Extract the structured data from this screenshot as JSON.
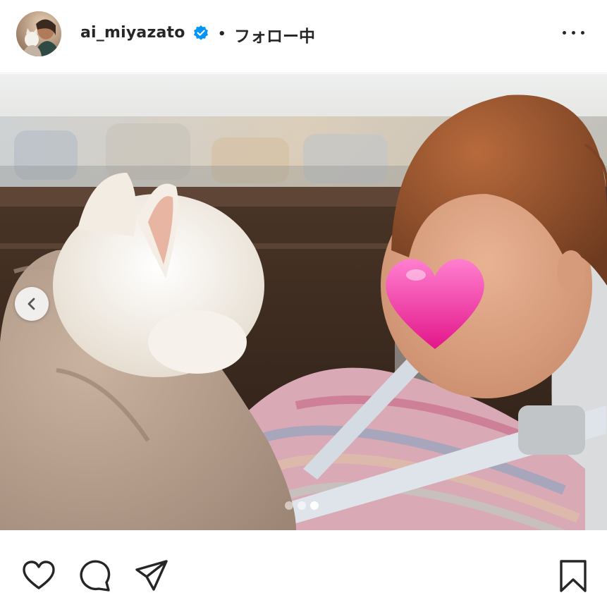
{
  "post_header": {
    "username": "ai_miyazato",
    "separator": "•",
    "follow_label": "フォロー中"
  },
  "carousel": {
    "slide_count": 3,
    "active_index": 2
  },
  "icons": {
    "verified": "verified-badge-icon",
    "more": "more-options-icon",
    "prev": "chevron-left-icon",
    "like": "heart-icon",
    "comment": "comment-icon",
    "share": "share-icon",
    "save": "bookmark-icon"
  },
  "colors": {
    "verified_badge": "#0095f6",
    "text": "#262626",
    "heart_sticker": "#f02a9a"
  }
}
